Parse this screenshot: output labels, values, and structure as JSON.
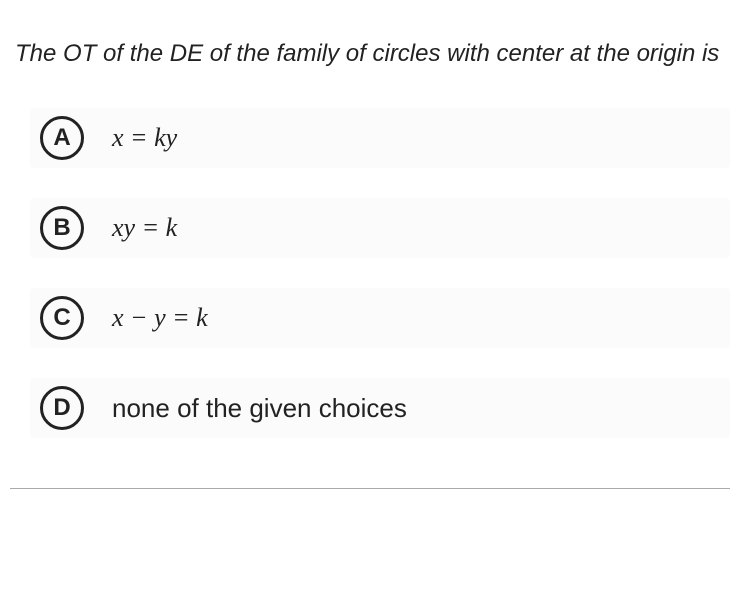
{
  "question": "The OT of the DE of the family of circles with center at the origin is",
  "options": [
    {
      "letter": "A",
      "text": "x = ky",
      "math": true
    },
    {
      "letter": "B",
      "text": "xy = k",
      "math": true
    },
    {
      "letter": "C",
      "text": "x − y = k",
      "math": true
    },
    {
      "letter": "D",
      "text": "none of the given choices",
      "math": false
    }
  ]
}
